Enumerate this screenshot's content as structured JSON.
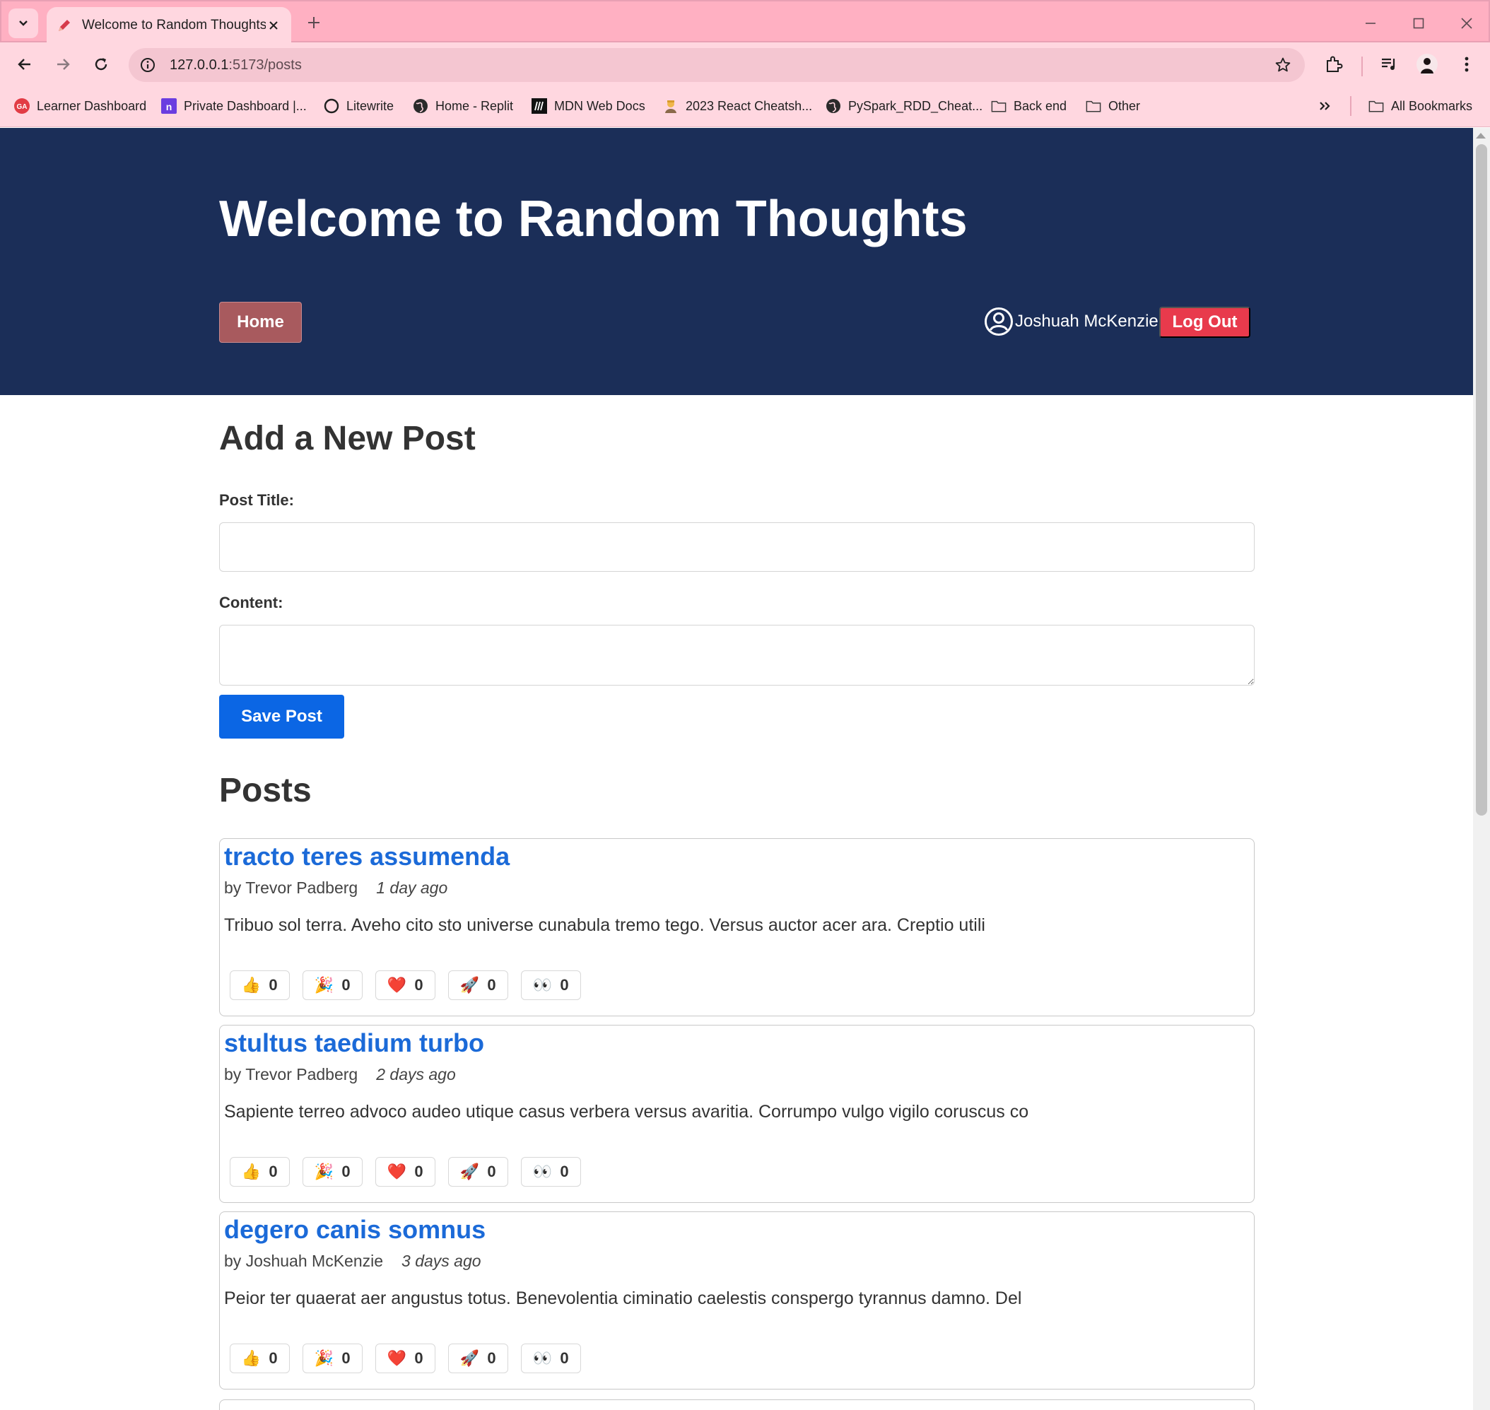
{
  "browser": {
    "tab_title": "Welcome to Random Thoughts",
    "url_host": "127.0.0.1",
    "url_path": ":5173/posts",
    "bookmarks": [
      {
        "label": "Learner Dashboard",
        "icon": "ga-icon"
      },
      {
        "label": "Private Dashboard |...",
        "icon": "n-icon"
      },
      {
        "label": "Litewrite",
        "icon": "circle-icon"
      },
      {
        "label": "Home - Replit",
        "icon": "globe-icon"
      },
      {
        "label": "MDN Web Docs",
        "icon": "mdn-icon"
      },
      {
        "label": "2023 React Cheatsh...",
        "icon": "person-icon"
      },
      {
        "label": "PySpark_RDD_Cheat...",
        "icon": "globe-icon"
      },
      {
        "label": "Back end",
        "icon": "folder-icon"
      },
      {
        "label": "Other",
        "icon": "folder-icon"
      }
    ],
    "all_bookmarks": "All Bookmarks"
  },
  "site": {
    "title": "Welcome to Random Thoughts",
    "nav_home": "Home",
    "user_name": "Joshuah McKenzie",
    "logout": "Log Out"
  },
  "form": {
    "heading": "Add a New Post",
    "title_label": "Post Title:",
    "title_value": "",
    "content_label": "Content:",
    "content_value": "",
    "save": "Save Post"
  },
  "posts_heading": "Posts",
  "posts": [
    {
      "title": "tracto teres assumenda",
      "author": "by Trevor Padberg",
      "time": "1 day ago",
      "body": "Tribuo sol terra. Aveho cito sto universe cunabula tremo tego. Versus auctor acer ara. Creptio utili",
      "reactions": [
        {
          "emoji": "👍",
          "name": "thumbs-up",
          "count": "0"
        },
        {
          "emoji": "🎉",
          "name": "party",
          "count": "0"
        },
        {
          "emoji": "❤️",
          "name": "heart",
          "count": "0"
        },
        {
          "emoji": "🚀",
          "name": "rocket",
          "count": "0"
        },
        {
          "emoji": "👀",
          "name": "eyes",
          "count": "0"
        }
      ]
    },
    {
      "title": "stultus taedium turbo",
      "author": "by Trevor Padberg",
      "time": "2 days ago",
      "body": "Sapiente terreo advoco audeo utique casus verbera versus avaritia. Corrumpo vulgo vigilo coruscus co",
      "reactions": [
        {
          "emoji": "👍",
          "name": "thumbs-up",
          "count": "0"
        },
        {
          "emoji": "🎉",
          "name": "party",
          "count": "0"
        },
        {
          "emoji": "❤️",
          "name": "heart",
          "count": "0"
        },
        {
          "emoji": "🚀",
          "name": "rocket",
          "count": "0"
        },
        {
          "emoji": "👀",
          "name": "eyes",
          "count": "0"
        }
      ]
    },
    {
      "title": "degero canis somnus",
      "author": "by Joshuah McKenzie",
      "time": "3 days ago",
      "body": "Peior ter quaerat aer angustus totus. Benevolentia ciminatio caelestis conspergo tyrannus damno. Del",
      "reactions": [
        {
          "emoji": "👍",
          "name": "thumbs-up",
          "count": "0"
        },
        {
          "emoji": "🎉",
          "name": "party",
          "count": "0"
        },
        {
          "emoji": "❤️",
          "name": "heart",
          "count": "0"
        },
        {
          "emoji": "🚀",
          "name": "rocket",
          "count": "0"
        },
        {
          "emoji": "👀",
          "name": "eyes",
          "count": "0"
        }
      ]
    }
  ],
  "colors": {
    "tabstrip": "#ffb0c2",
    "toolbar": "#ffd7e0",
    "header_bg": "#1b2e58",
    "home_btn": "#a85a5e",
    "logout_btn": "#e83a4c",
    "save_btn": "#0b66e4",
    "post_title": "#1b6ad8"
  }
}
